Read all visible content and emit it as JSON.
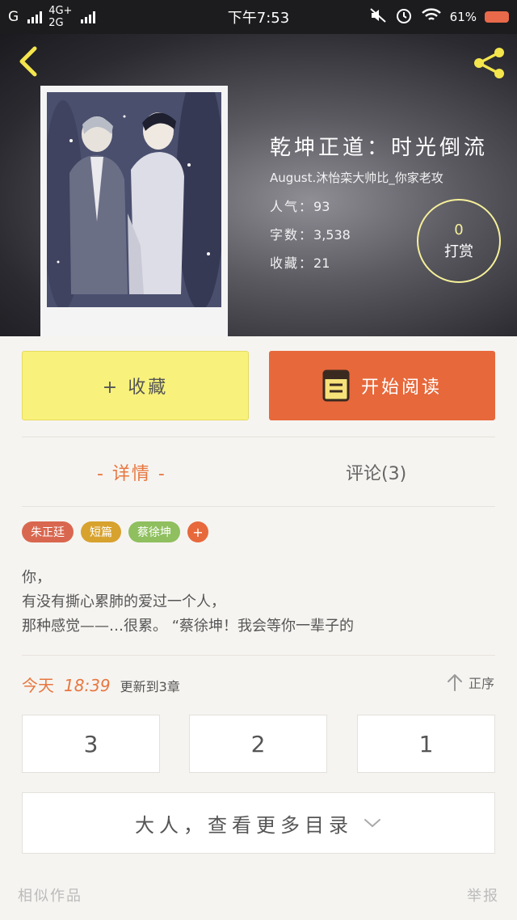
{
  "status_bar": {
    "carrier_1": "G",
    "network_1": "4G+",
    "network_2": "2G",
    "time": "下午7:53",
    "battery": "61%"
  },
  "book": {
    "title": "乾坤正道：时光倒流",
    "author": "August.沐怡栾大帅比_你家老攻",
    "popularity_label": "人气：",
    "popularity": "93",
    "words_label": "字数：",
    "words": "3,538",
    "favorites_label": "收藏：",
    "favorites": "21",
    "reward_count": "0",
    "reward_label": "打赏"
  },
  "actions": {
    "collect_label": "+ 收藏",
    "read_label": "开始阅读"
  },
  "tabs": {
    "detail": "- 详情 -",
    "comments": "评论(3)"
  },
  "tags": [
    {
      "label": "朱正廷",
      "color": "#d9674f"
    },
    {
      "label": "短篇",
      "color": "#d7a22e"
    },
    {
      "label": "蔡徐坤",
      "color": "#8fbf5e"
    },
    {
      "label": "+",
      "color": "#e7683b"
    }
  ],
  "synopsis": [
    "你，",
    "有没有撕心累肺的爱过一个人，",
    "那种感觉——…很累。  “蔡徐坤！我会等你一辈子的"
  ],
  "update": {
    "day": "今天",
    "time": "18:39",
    "text": "更新到3章"
  },
  "sort_label": "正序",
  "chapters": [
    "3",
    "2",
    "1"
  ],
  "more_label": "大人，查看更多目录",
  "footer": {
    "similar": "相似作品",
    "report": "举报"
  },
  "colors": {
    "accent": "#e7773f",
    "read_button": "#e7683b",
    "collect_button": "#f8f27c"
  }
}
